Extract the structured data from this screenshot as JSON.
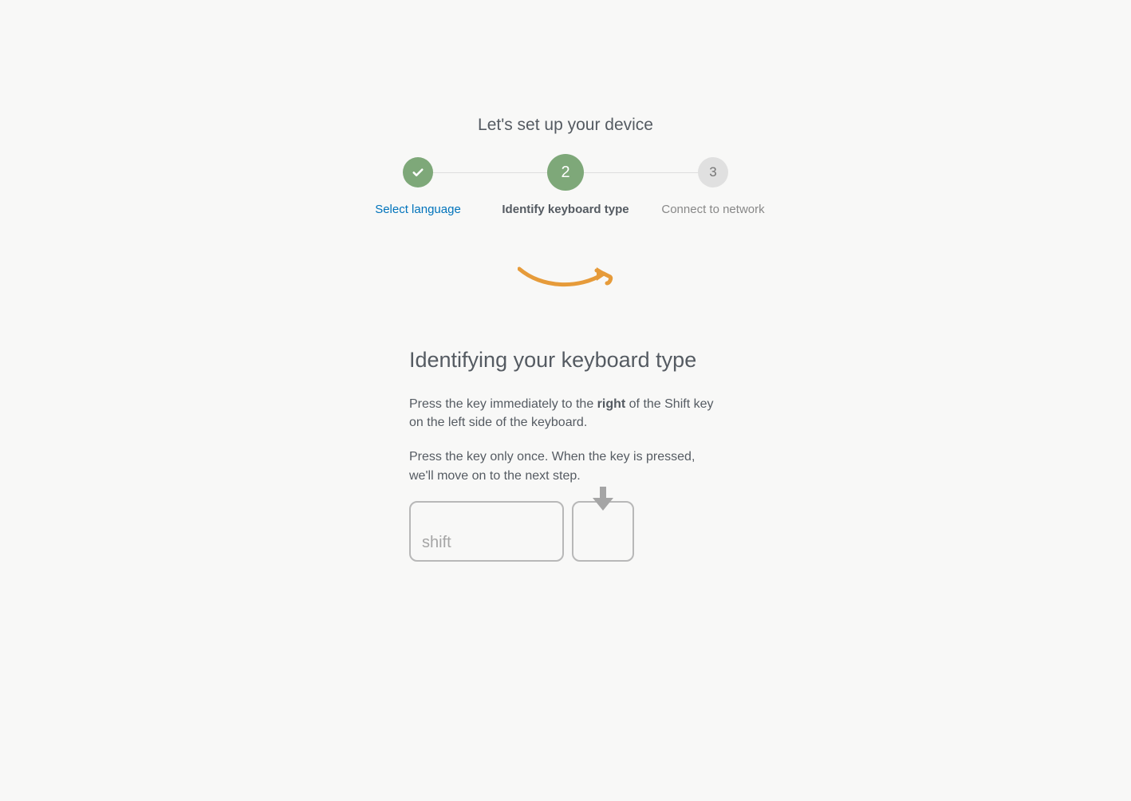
{
  "page_title": "Let's set up your device",
  "stepper": {
    "steps": [
      {
        "label": "Select language",
        "state": "done"
      },
      {
        "label": "Identify keyboard type",
        "state": "current",
        "num": "2"
      },
      {
        "label": "Connect to network",
        "state": "pending",
        "num": "3"
      }
    ]
  },
  "heading": "Identifying your keyboard type",
  "instructions": {
    "p1_a": "Press the key immediately to the ",
    "p1_bold": "right",
    "p1_b": " of the Shift key on the left side of the keyboard.",
    "p2": "Press the key only once. When the key is pressed, we'll move on to the next step."
  },
  "key_label": "shift"
}
